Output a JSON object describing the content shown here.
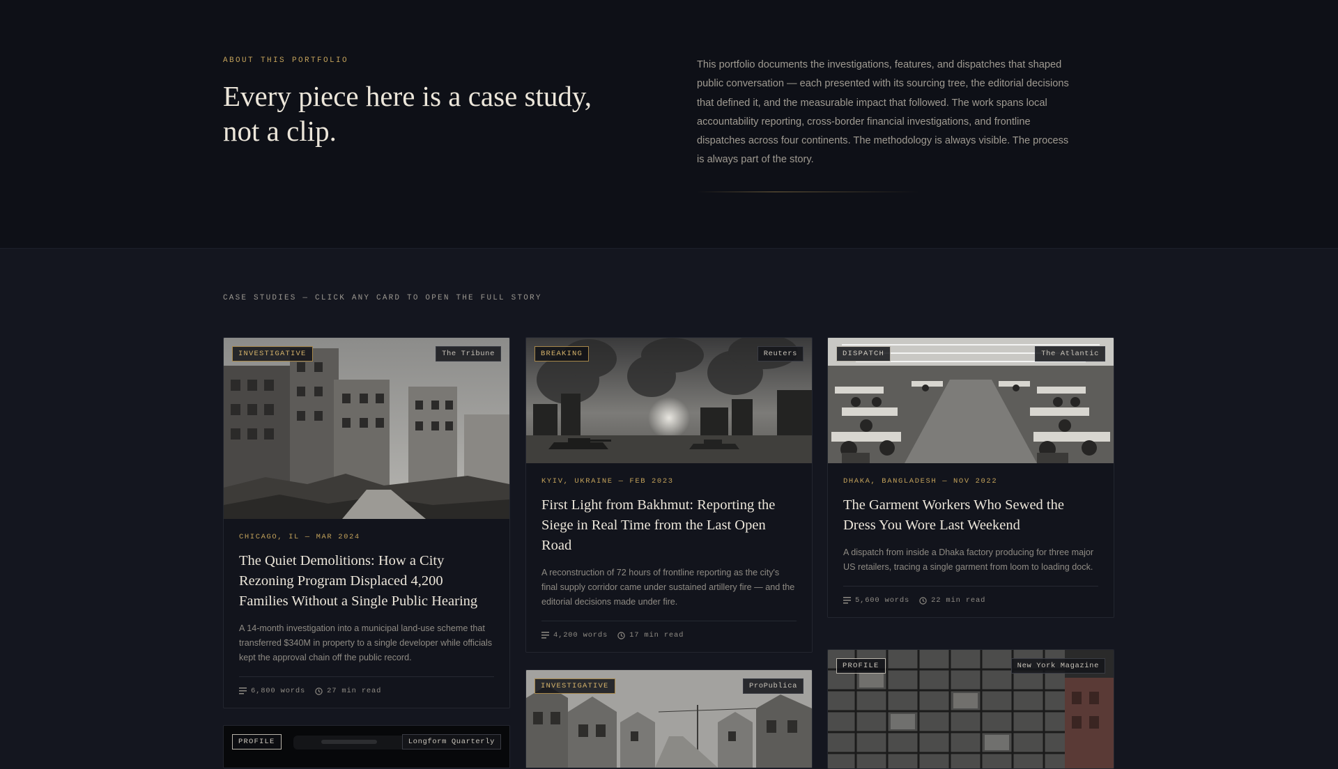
{
  "about": {
    "eyebrow": "ABOUT THIS PORTFOLIO",
    "headline": "Every piece here is a case study, not a clip.",
    "intro": "This portfolio documents the investigations, features, and dispatches that shaped public conversation — each presented with its sourcing tree, the editorial decisions that defined it, and the measurable impact that followed. The work spans local accountability reporting, cross-border financial investigations, and frontline dispatches across four continents. The methodology is always visible. The process is always part of the story."
  },
  "case_studies": {
    "label": "CASE STUDIES — CLICK ANY CARD TO OPEN THE FULL STORY",
    "cards": [
      {
        "category": "INVESTIGATIVE",
        "publication": "The Tribune",
        "location": "CHICAGO, IL — MAR 2024",
        "title": "The Quiet Demolitions: How a City Rezoning Program Displaced 4,200 Families Without a Single Public Hearing",
        "description": "A 14-month investigation into a municipal land-use scheme that transferred $340M in property to a single developer while officials kept the approval chain off the public record.",
        "words": "6,800 words",
        "read": "27 min read"
      },
      {
        "category": "BREAKING",
        "publication": "Reuters",
        "location": "KYIV, UKRAINE — FEB 2023",
        "title": "First Light from Bakhmut: Reporting the Siege in Real Time from the Last Open Road",
        "description": "A reconstruction of 72 hours of frontline reporting as the city's final supply corridor came under sustained artillery fire — and the editorial decisions made under fire.",
        "words": "4,200 words",
        "read": "17 min read"
      },
      {
        "category": "DISPATCH",
        "publication": "The Atlantic",
        "location": "DHAKA, BANGLADESH — NOV 2022",
        "title": "The Garment Workers Who Sewed the Dress You Wore Last Weekend",
        "description": "A dispatch from inside a Dhaka factory producing for three major US retailers, tracing a single garment from loom to loading dock.",
        "words": "5,600 words",
        "read": "22 min read"
      },
      {
        "category": "PROFILE",
        "publication": "Longform Quarterly"
      },
      {
        "category": "INVESTIGATIVE",
        "publication": "ProPublica"
      },
      {
        "category": "PROFILE",
        "publication": "New York Magazine"
      }
    ]
  },
  "colors": {
    "accent": "#c2a15a",
    "background": "#14161f",
    "hero_background": "#0e1017"
  }
}
